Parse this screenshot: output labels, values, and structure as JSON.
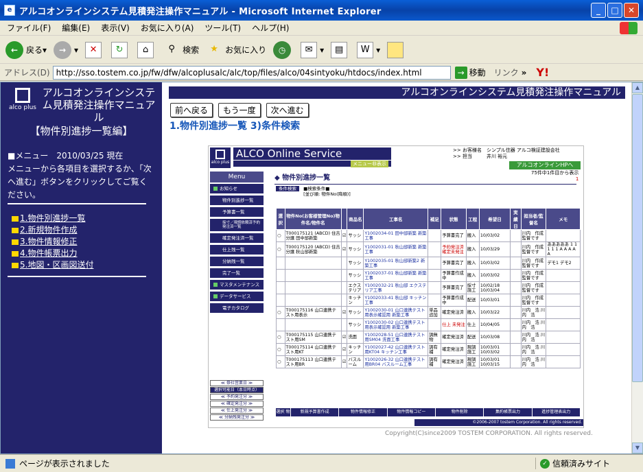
{
  "window": {
    "title": "アルコオンラインシステム見積発注操作マニュアル - Microsoft Internet Explorer"
  },
  "menubar": [
    "ファイル(F)",
    "編集(E)",
    "表示(V)",
    "お気に入り(A)",
    "ツール(T)",
    "ヘルプ(H)"
  ],
  "toolbar": {
    "back": "戻る",
    "search": "検索",
    "favorites": "お気に入り"
  },
  "address": {
    "label": "アドレス(D)",
    "url": "http://sso.tostem.co.jp/fw/dfw/alcoplusalc/alc/top/files/alco/04sintyoku/htdocs/index.html",
    "go": "移動",
    "links": "リンク"
  },
  "sidebar": {
    "logo_text": "alco plus",
    "title": "アルコオンラインシステム見積発注操作マニュアル",
    "subtitle": "【物件別進捗一覧編】",
    "menu_line": "■メニュー　2010/03/25 現在",
    "menu_desc": "メニューから各項目を選択するか、「次へ進む」ボタンをクリックしてご覧ください。",
    "links": [
      "1.物件別進捗一覧",
      "2.新規物件作成",
      "3.物件情報修正",
      "4.物件帳票出力",
      "5.地図・区画図送付"
    ]
  },
  "main": {
    "header": "アルコオンラインシステム見積発注操作マニュアル",
    "buttons": [
      "前へ戻る",
      "もう一度",
      "次へ進む"
    ],
    "section_title": "1.物件別進捗一覧 3)条件検索"
  },
  "shot": {
    "logo": "alco plus",
    "title": "ALCO Online Service",
    "menu_label": "メニュー非表示",
    "user_lines": [
      ">> お客様名　シンプル住器 アルコ検証建設会社",
      ">> 担当　　　井川 裕元"
    ],
    "hp_link": "アルコオンラインHPへ",
    "menu_btn": "Menu",
    "side_items": [
      "お知らせ",
      "物件別進捗一覧",
      "予算書一覧",
      "採寸／現調依頼済予約発注済一覧",
      "確定発注済一覧",
      "仕上残一覧",
      "分納残一覧",
      "完了一覧",
      "マスタメンテナンス",
      "データサービス",
      "電子カタログ"
    ],
    "lower_items": [
      "≪ 祭社営業日 ≫",
      "選択可能日（本日時点）",
      "≪ 予約発注分 ≫",
      "≪ 確定発注分 ≫",
      "≪ 仕上発注分 ≫",
      "≪ 分納残発注分 ≫"
    ],
    "page_title": "◆ 物件別進捗一覧",
    "count": "75件中1件目から表示",
    "count_page": "1",
    "filter_tag": "条件検索",
    "filter_lines": [
      "■検索条件■",
      "[並び順: 物件No(降順)]"
    ],
    "headers": [
      "選択",
      "物件No(お客様管理No)物件名/物件名",
      "",
      "商品名",
      "工事名",
      "補足",
      "状態",
      "工程",
      "希望日",
      "実績日",
      "担当者/監督名",
      "メモ"
    ],
    "rows": [
      [
        "○",
        "T000175121 (ABCD) 住吉分譲 田中邸新築",
        "☑",
        "サッシ",
        "Y1002034-01 田中邸新築 新築工事",
        "",
        "予算書完了",
        "搬入",
        "10/03/02",
        "",
        "川内　作成 監督です",
        ""
      ],
      [
        "○",
        "T000175120 (ABCD) 住吉分譲 秋山邸新築",
        "☑",
        "サッシ",
        "Y1002031-01 秋山邸新築 新築工事",
        "",
        "予約発注済 確定未発注",
        "搬入",
        "10/03/29",
        "",
        "川内　作成 監督です",
        "あああああ 1 1 1 1 1 A A A A A"
      ],
      [
        "",
        "",
        "",
        "サッシ",
        "Y1002035-01 秋山邸新築2 新築工事",
        "",
        "予算書完了",
        "搬入",
        "10/03/02",
        "",
        "川内　作成 監督です",
        "デモ1 デモ2"
      ],
      [
        "",
        "",
        "",
        "サッシ",
        "Y1002037-01 秋山邸新築 新築工事",
        "",
        "予算書作成中",
        "搬入",
        "10/03/02",
        "",
        "川内　作成 監督です",
        ""
      ],
      [
        "",
        "",
        "",
        "エクステリア",
        "Y1002032-21 秋山邸 エクステリア工事",
        "",
        "予算書完了",
        "採寸 施工",
        "10/02/18 10/03/04",
        "",
        "川内　作成 監督です",
        ""
      ],
      [
        "",
        "",
        "",
        "キッチン",
        "Y1002033-41 秋山邸 キッチン工事",
        "",
        "予算書作成中",
        "配送",
        "10/03/01",
        "",
        "川内　作成 監督です",
        ""
      ],
      [
        "○",
        "T000175116 山口連携テスト用表示",
        "☑",
        "サッシ",
        "Y1002030-01 山口連携テスト用表示確認用 新築工事",
        "単品 追加",
        "確定発注済",
        "搬入",
        "10/03/22",
        "",
        "川内　浩 川内　浩",
        ""
      ],
      [
        "",
        "",
        "",
        "サッシ",
        "Y1002030-02 山口連携テスト用表示確認用 新築工事",
        "",
        "仕上 未発注",
        "仕上",
        "10/04/05",
        "",
        "川内　浩 川内　浩",
        ""
      ],
      [
        "○",
        "T000175115 山口連携テスト用SM",
        "☑",
        "洗面",
        "Y1002028-51 山口連携テスト用SM04 洗面工事",
        "調無物",
        "確定発注済",
        "配送",
        "10/03/08",
        "",
        "川内　浩 川内　浩",
        ""
      ],
      [
        "○",
        "T000175114 山口連携テスト用KT",
        "☑",
        "キッチン",
        "Y1002027-42 山口連携テスト用KT04 キッチン工事",
        "調有補",
        "確定発注済",
        "現調 施工",
        "10/03/01 10/03/02",
        "",
        "川内　浩 川内　浩",
        ""
      ],
      [
        "○",
        "T000175113 山口連携テスト用BR",
        "☑",
        "バスルーム",
        "Y1002026-32 山口連携テスト用BR04 バスルーム工事",
        "調有補",
        "確定発注済",
        "現調 施工",
        "10/03/01 10/03/15",
        "",
        "川内　浩 川内　浩",
        ""
      ]
    ],
    "bottom_label": "選択 物件",
    "bottom_buttons": [
      "新規予算書作成",
      "物件情報修正",
      "物件情報コピー",
      "物件削除",
      "集約帳票出力",
      "進捗管理表出力"
    ],
    "copy": "©2006-2007 tostem Corporation. All rights reserved."
  },
  "copyright": "Copyright(C)since2009 TOSTEM CORPORATION. All rights reserved.",
  "status": {
    "text": "ページが表示されました",
    "zone": "信頼済みサイト"
  }
}
